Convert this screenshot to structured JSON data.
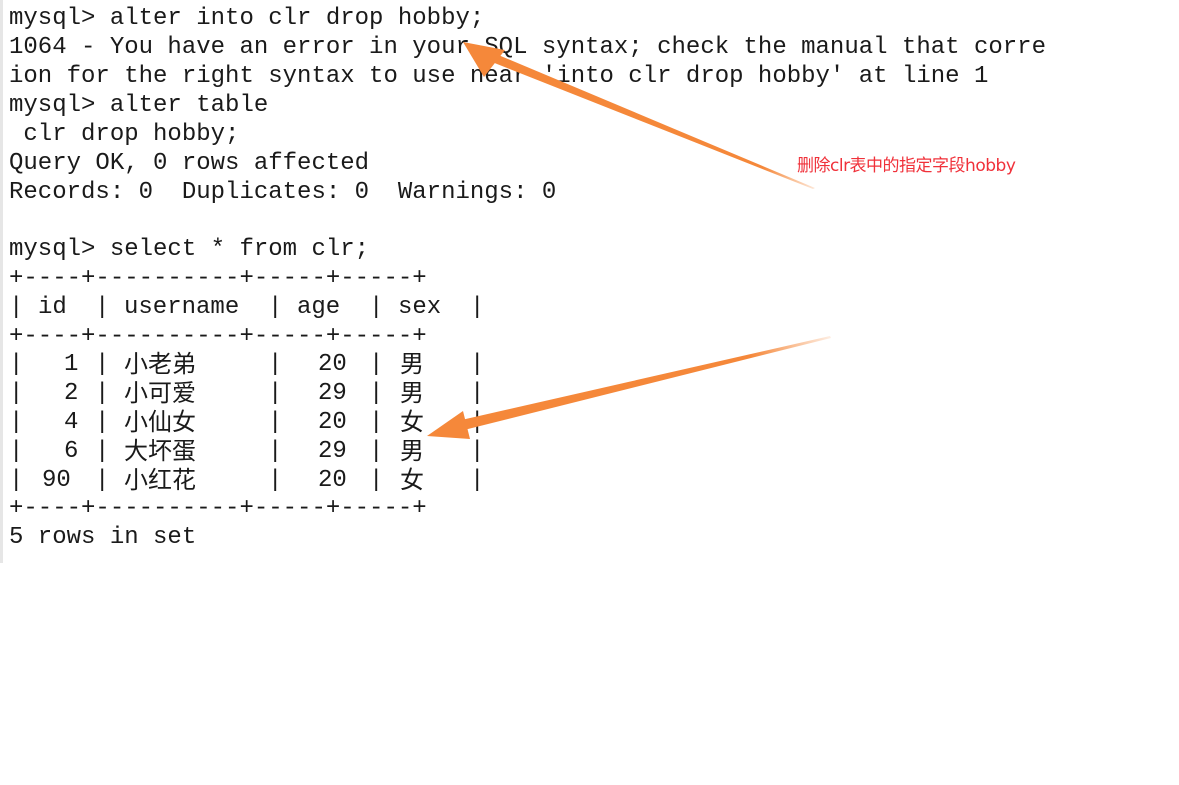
{
  "terminal": {
    "lines": [
      "mysql> alter into clr drop hobby;",
      "1064 - You have an error in your SQL syntax; check the manual that corre",
      "ion for the right syntax to use near 'into clr drop hobby' at line 1",
      "mysql> alter table",
      " clr drop hobby;",
      "Query OK, 0 rows affected",
      "Records: 0  Duplicates: 0  Warnings: 0",
      "",
      "mysql> select * from clr;"
    ],
    "table": {
      "border": "+----+----------+-----+-----+",
      "headers": [
        "id",
        "username",
        "age",
        "sex"
      ],
      "rows": [
        {
          "id": "1",
          "username": "小老弟",
          "age": "20",
          "sex": "男"
        },
        {
          "id": "2",
          "username": "小可爱",
          "age": "29",
          "sex": "男"
        },
        {
          "id": "4",
          "username": "小仙女",
          "age": "20",
          "sex": "女"
        },
        {
          "id": "6",
          "username": "大坏蛋",
          "age": "29",
          "sex": "男"
        },
        {
          "id": "90",
          "username": "小红花",
          "age": "20",
          "sex": "女"
        }
      ],
      "pipe": "|"
    },
    "summary": "5 rows in set"
  },
  "annotations": {
    "note": "删除clr表中的指定字段hobby",
    "arrow_color": "#f5883a",
    "note_color": "#f0313a"
  }
}
